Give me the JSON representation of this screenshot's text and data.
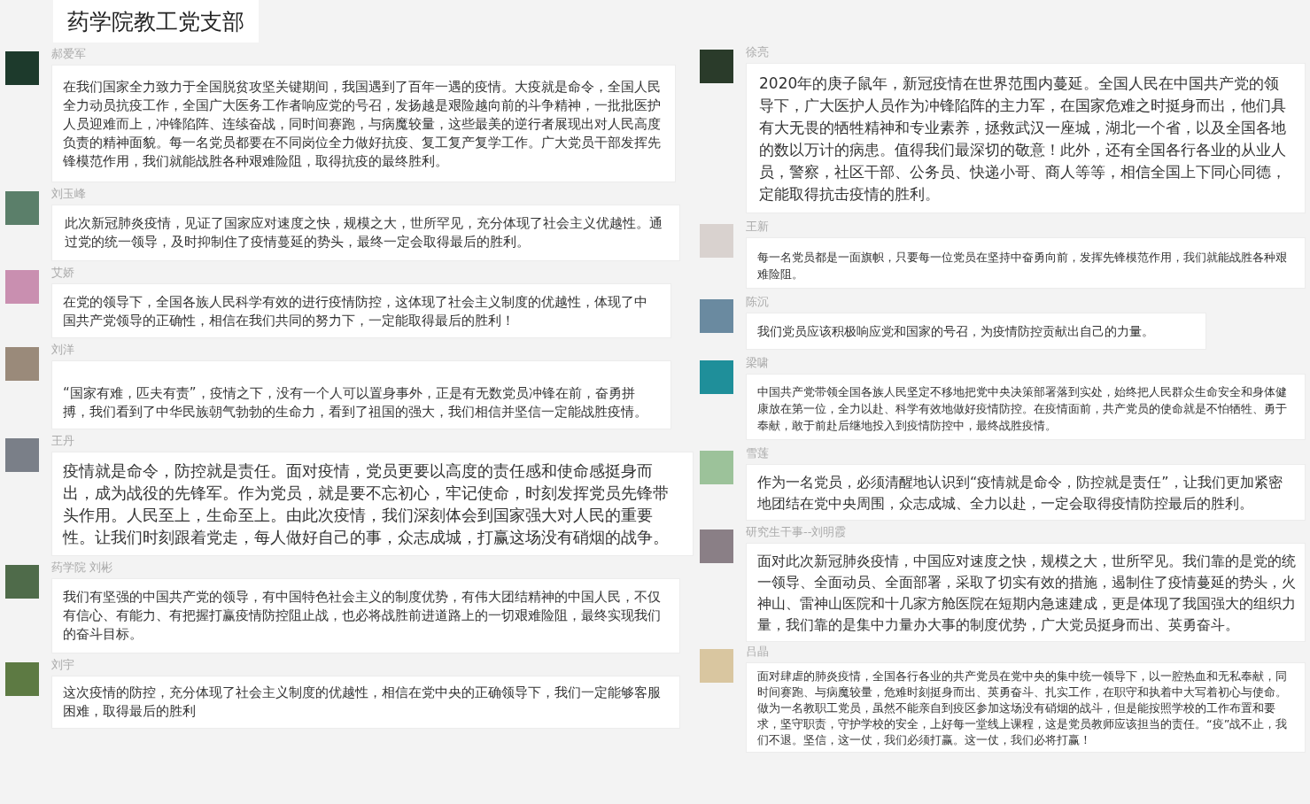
{
  "title": "药学院教工党支部",
  "columns": [
    {
      "messages": [
        {
          "sender": "郝爱军",
          "text": "在我们国家全力致力于全国脱贫攻坚关键期间，我国遇到了百年一遇的疫情。大疫就是命令，全国人民全力动员抗疫工作，全国广大医务工作者响应党的号召，发扬越是艰险越向前的斗争精神，一批批医护人员迎难而上，冲锋陷阵、连续奋战，同时间赛跑，与病魔较量，这些最美的逆行者展现出对人民高度负责的精神面貌。每一名党员都要在不同岗位全力做好抗疫、复工复产复学工作。广大党员干部发挥先锋模范作用，我们就能战胜各种艰难险阻，取得抗疫的最终胜利。"
        },
        {
          "sender": "刘玉峰",
          "text": "此次新冠肺炎疫情，见证了国家应对速度之快，规模之大，世所罕见，充分体现了社会主义优越性。通过党的统一领导，及时抑制住了疫情蔓延的势头，最终一定会取得最后的胜利。"
        },
        {
          "sender": "艾娇",
          "text": "在党的领导下，全国各族人民科学有效的进行疫情防控，这体现了社会主义制度的优越性，体现了中国共产党领导的正确性，相信在我们共同的努力下，一定能取得最后的胜利！"
        },
        {
          "sender": "刘洋",
          "text": "“国家有难，匹夫有责”，疫情之下，没有一个人可以置身事外，正是有无数党员冲锋在前，奋勇拼搏，我们看到了中华民族朝气勃勃的生命力，看到了祖国的强大，我们相信并坚信一定能战胜疫情。"
        },
        {
          "sender": "王丹",
          "text": "疫情就是命令，防控就是责任。面对疫情，党员更要以高度的责任感和使命感挺身而出，成为战役的先锋军。作为党员，就是要不忘初心，牢记使命，时刻发挥党员先锋带头作用。人民至上，生命至上。由此次疫情，我们深刻体会到国家强大对人民的重要性。让我们时刻跟着党走，每人做好自己的事，众志成城，打赢这场没有硝烟的战争。"
        },
        {
          "sender": "药学院 刘彬",
          "text": "我们有坚强的中国共产党的领导，有中国特色社会主义的制度优势，有伟大团结精神的中国人民，不仅有信心、有能力、有把握打赢疫情防控阻止战，也必将战胜前进道路上的一切艰难险阻，最终实现我们的奋斗目标。"
        },
        {
          "sender": "刘宇",
          "text": "这次疫情的防控，充分体现了社会主义制度的优越性，相信在党中央的正确领导下，我们一定能够客服困难，取得最后的胜利"
        }
      ]
    },
    {
      "messages": [
        {
          "sender": "徐亮",
          "text": "2020年的庚子鼠年，新冠疫情在世界范围内蔓延。全国人民在中国共产党的领导下，广大医护人员作为冲锋陷阵的主力军，在国家危难之时挺身而出，他们具有大无畏的牺牲精神和专业素养，拯救武汉一座城，湖北一个省，以及全国各地的数以万计的病患。值得我们最深切的敬意！此外，还有全国各行各业的从业人员，警察，社区干部、公务员、快递小哥、商人等等，相信全国上下同心同德，定能取得抗击疫情的胜利。"
        },
        {
          "sender": "王新",
          "text": "每一名党员都是一面旗帜，只要每一位党员在坚持中奋勇向前，发挥先锋模范作用，我们就能战胜各种艰难险阻。"
        },
        {
          "sender": "陈沉",
          "text": "我们党员应该积极响应党和国家的号召，为疫情防控贡献出自己的力量。"
        },
        {
          "sender": "梁啸",
          "text": "中国共产党带领全国各族人民坚定不移地把党中央决策部署落到实处，始终把人民群众生命安全和身体健康放在第一位，全力以赴、科学有效地做好疫情防控。在疫情面前，共产党员的使命就是不怕牺牲、勇于奉献，敢于前赴后继地投入到疫情防控中，最终战胜疫情。"
        },
        {
          "sender": "雪莲",
          "text": "作为一名党员，必须清醒地认识到“疫情就是命令，防控就是责任”，让我们更加紧密地团结在党中央周围，众志成城、全力以赴，一定会取得疫情防控最后的胜利。"
        },
        {
          "sender": "研究生干事--刘明霞",
          "text": "面对此次新冠肺炎疫情，中国应对速度之快，规模之大，世所罕见。我们靠的是党的统一领导、全面动员、全面部署，采取了切实有效的措施，遏制住了疫情蔓延的势头，火神山、雷神山医院和十几家方舱医院在短期内急速建成，更是体现了我国强大的组织力量，我们靠的是集中力量办大事的制度优势，广大党员挺身而出、英勇奋斗。"
        },
        {
          "sender": "吕晶",
          "text": "面对肆虐的肺炎疫情，全国各行各业的共产党员在党中央的集中统一领导下，以一腔热血和无私奉献，同时间赛跑、与病魔较量，危难时刻挺身而出、英勇奋斗、扎实工作，在职守和执着中大写着初心与使命。做为一名教职工党员，虽然不能亲自到疫区参加这场没有硝烟的战斗，但是能按照学校的工作布置和要求，坚守职责，守护学校的安全，上好每一堂线上课程，这是党员教师应该担当的责任。“疫”战不止，我们不退。坚信，这一仗，我们必须打赢。这一仗，我们必将打赢！"
        }
      ]
    }
  ]
}
